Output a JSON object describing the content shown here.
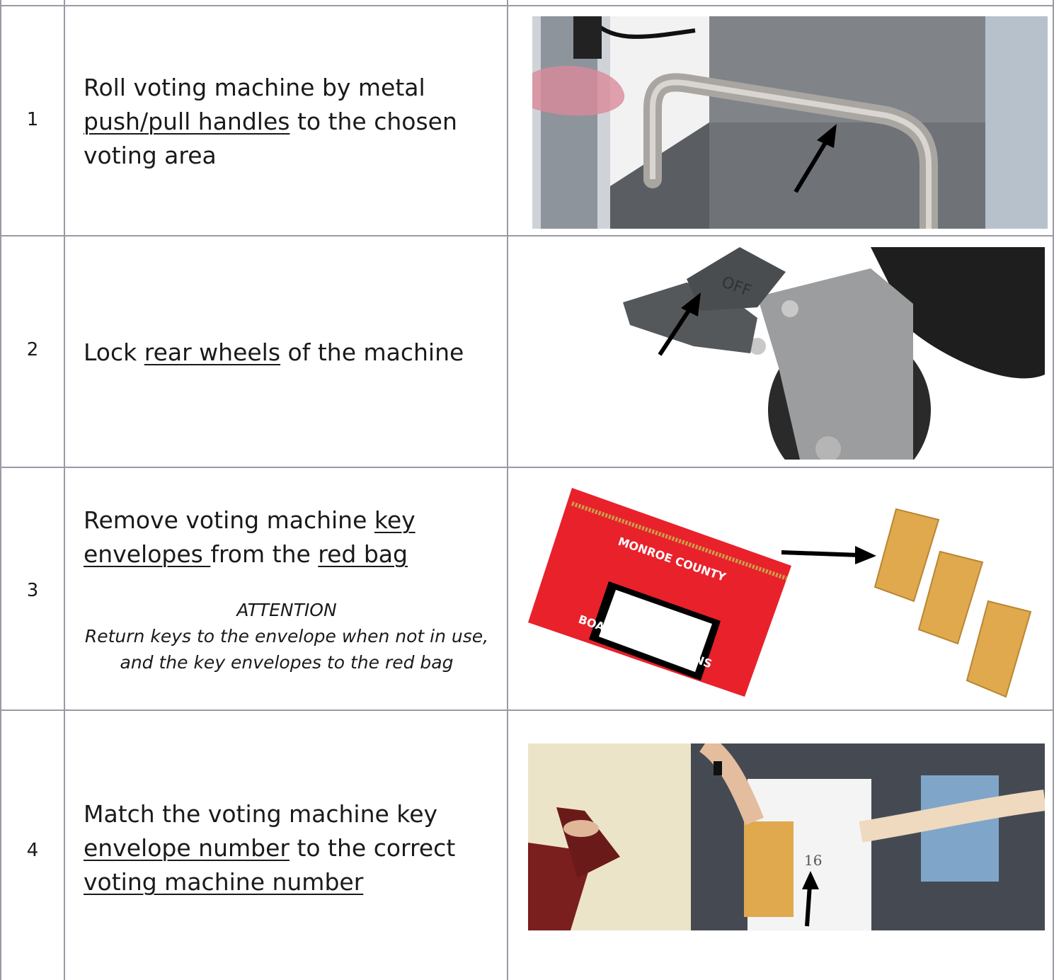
{
  "steps": [
    {
      "number": "1",
      "text": [
        "Roll voting machine by metal ",
        "push/pull handles",
        " to the chosen voting area"
      ]
    },
    {
      "number": "2",
      "text": [
        "Lock ",
        "rear wheels",
        " of the machine"
      ]
    },
    {
      "number": "3",
      "text": [
        "Remove voting machine ",
        "key envelopes ",
        "from the ",
        "red bag"
      ],
      "note_title": "ATTENTION",
      "note_body": "Return keys to the envelope when not in use, and the key envelopes to the red bag"
    },
    {
      "number": "4",
      "text": [
        "Match the voting machine key ",
        "envelope number",
        " to the correct ",
        "voting machine number"
      ]
    }
  ],
  "images": {
    "bag_top_text": "MONROE COUNTY",
    "bag_bottom_text": "BOARD OF ELECTIONS",
    "pedal_label": "OFF",
    "sign_number": "16"
  },
  "colors": {
    "grid": "#9a9aa6",
    "bag_red": "#e8212b",
    "envelope": "#e0a94e"
  }
}
